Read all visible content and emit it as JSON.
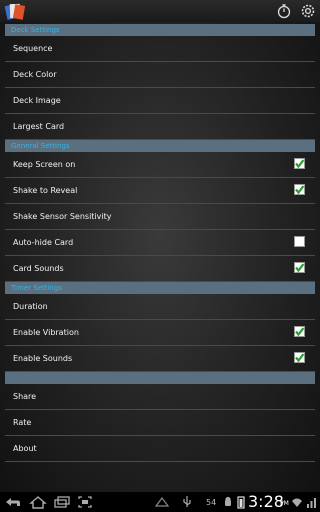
{
  "sections": [
    {
      "header": "Deck Settings",
      "items": [
        {
          "label": "Sequence"
        },
        {
          "label": "Deck Color"
        },
        {
          "label": "Deck Image"
        },
        {
          "label": "Largest Card"
        }
      ]
    },
    {
      "header": "General Settings",
      "items": [
        {
          "label": "Keep Screen on",
          "checked": true
        },
        {
          "label": "Shake to Reveal",
          "checked": true
        },
        {
          "label": "Shake Sensor Sensitivity"
        },
        {
          "label": "Auto-hide Card",
          "checked": false
        },
        {
          "label": "Card Sounds",
          "checked": true
        }
      ]
    },
    {
      "header": "Timer Settings",
      "items": [
        {
          "label": "Duration"
        },
        {
          "label": "Enable Vibration",
          "checked": true
        },
        {
          "label": "Enable Sounds",
          "checked": true
        }
      ]
    },
    {
      "header": "",
      "items": [
        {
          "label": "Share"
        },
        {
          "label": "Rate"
        },
        {
          "label": "About"
        }
      ]
    }
  ],
  "status_bar": {
    "notification_count": "54",
    "time": "3:28",
    "ampm": "PM"
  },
  "colors": {
    "header_bg": "#5a6f80",
    "header_text": "#33b5e5",
    "check_green": "#2e9e2e"
  },
  "icons": {
    "app": "card-deck-icon",
    "timer": "timer-icon",
    "settings": "settings-icon"
  }
}
